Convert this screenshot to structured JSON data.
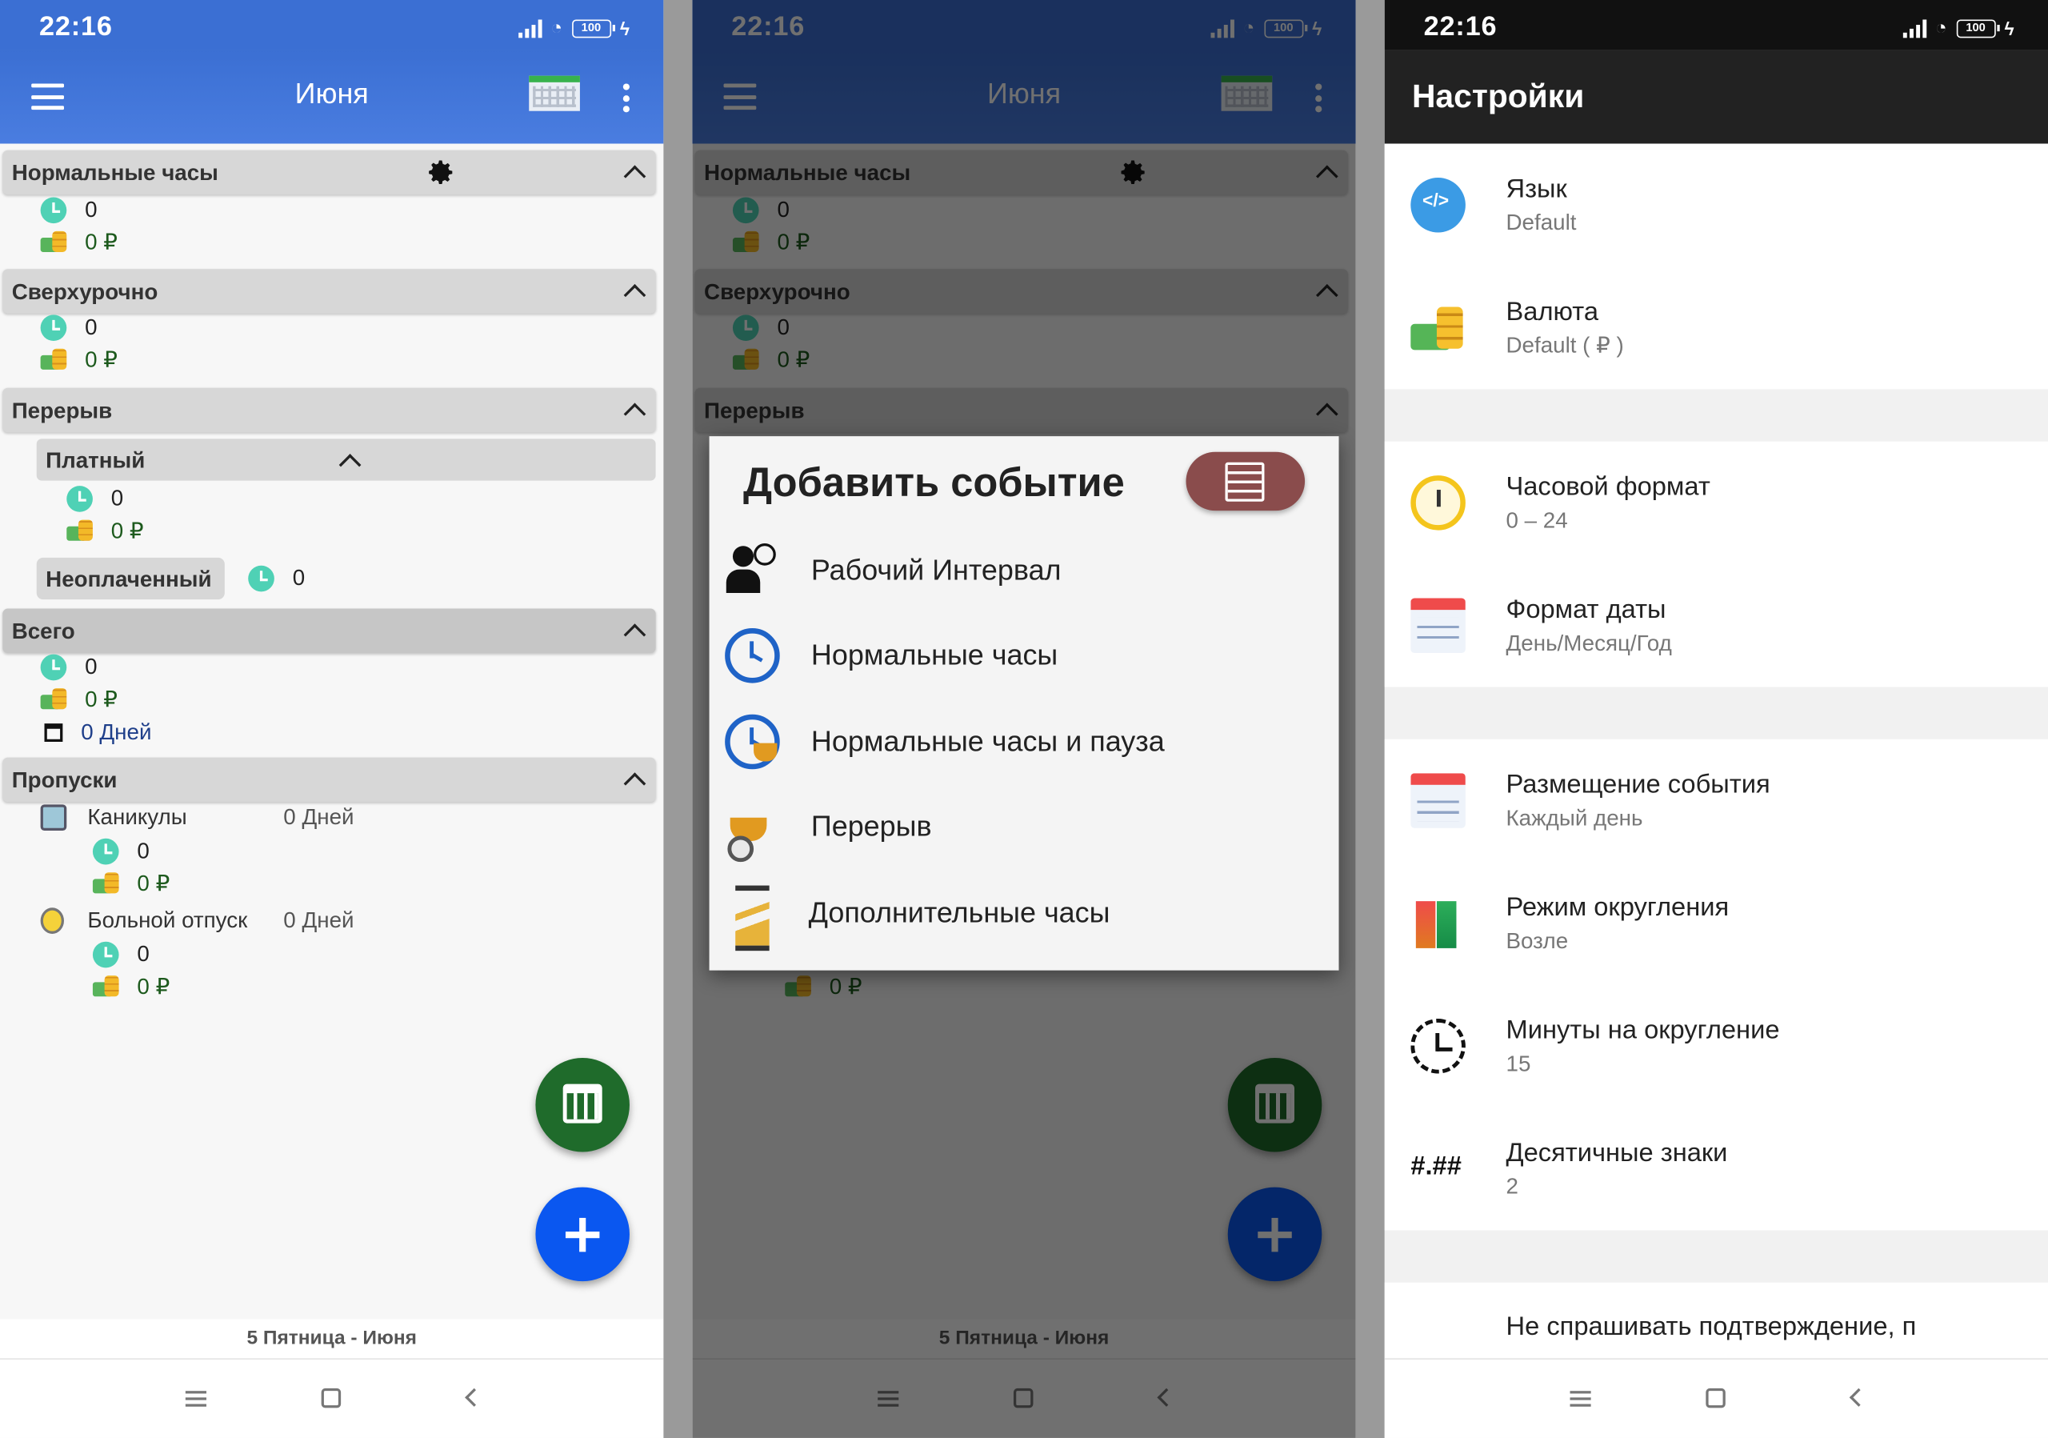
{
  "status": {
    "time": "22:16",
    "battery": "100"
  },
  "screen1": {
    "title": "Июня",
    "sections": {
      "normal": {
        "label": "Нормальные часы",
        "hours": "0",
        "money": "0 ₽"
      },
      "overtime": {
        "label": "Сверхурочно",
        "hours": "0",
        "money": "0 ₽"
      },
      "break": {
        "label": "Перерыв",
        "paid": {
          "label": "Платный",
          "hours": "0",
          "money": "0 ₽"
        },
        "unpaid": {
          "label": "Неоплаченный",
          "hours": "0"
        }
      },
      "total": {
        "label": "Всего",
        "hours": "0",
        "money": "0 ₽",
        "days": "0 Дней"
      },
      "absences": {
        "label": "Пропуски",
        "vacation": {
          "label": "Каникулы",
          "days": "0 Дней",
          "hours": "0",
          "money": "0 ₽"
        },
        "sick": {
          "label": "Больной отпуск",
          "days": "0 Дней",
          "hours": "0",
          "money": "0 ₽"
        }
      }
    },
    "bottom_date": "5 Пятница - Июня"
  },
  "screen2": {
    "dialog": {
      "title": "Добавить событие",
      "items": [
        {
          "label": "Рабочий Интервал",
          "icon": "person-clock-icon"
        },
        {
          "label": "Нормальные часы",
          "icon": "clock-icon"
        },
        {
          "label": "Нормальные часы и пауза",
          "icon": "clock-coffee-icon"
        },
        {
          "label": "Перерыв",
          "icon": "coffee-break-icon"
        },
        {
          "label": "Дополнительные часы",
          "icon": "hourglass-icon"
        }
      ]
    }
  },
  "screen3": {
    "title": "Настройки",
    "items": [
      {
        "title": "Язык",
        "value": "Default",
        "icon": "language-icon"
      },
      {
        "title": "Валюта",
        "value": "Default ( ₽ )",
        "icon": "currency-icon"
      },
      {
        "title": "Часовой формат",
        "value": "0 – 24",
        "icon": "clock-format-icon"
      },
      {
        "title": "Формат даты",
        "value": "День/Месяц/Год",
        "icon": "date-format-icon"
      },
      {
        "title": "Размещение события",
        "value": "Каждый день",
        "icon": "event-calendar-icon"
      },
      {
        "title": "Режим округления",
        "value": "Возле",
        "icon": "rounding-icon"
      },
      {
        "title": "Минуты на округление",
        "value": "15",
        "icon": "round-minutes-icon"
      },
      {
        "title": "Десятичные знаки",
        "value": "2",
        "icon": "decimal-icon",
        "symbol": "#.##"
      },
      {
        "title": "Не спрашивать подтверждение, п"
      }
    ]
  },
  "colors": {
    "appbar": "#3b6fd3",
    "fab_calendar": "#1f6b2b",
    "fab_add": "#0a57f0",
    "settings_bar": "#222222",
    "dialog_button": "#8a4c4c"
  }
}
